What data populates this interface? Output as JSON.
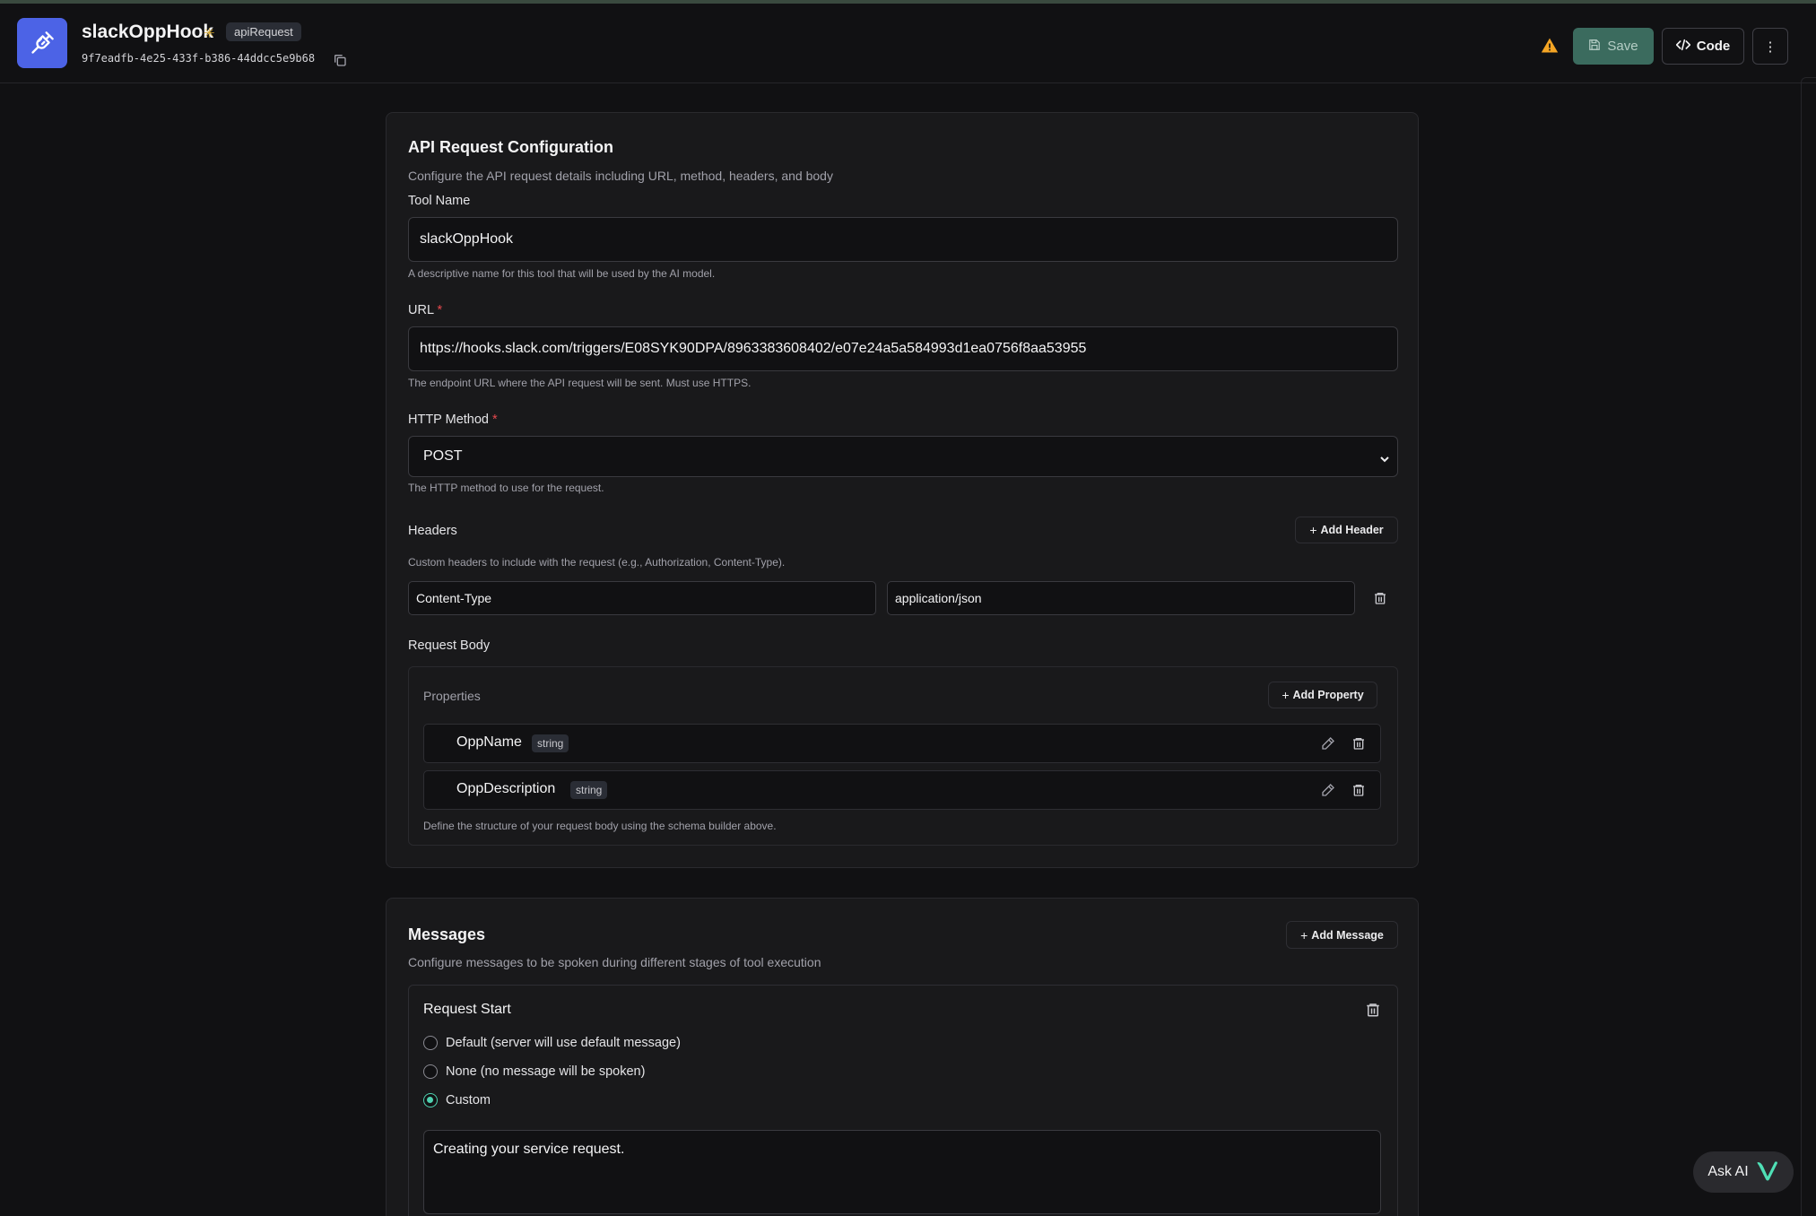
{
  "header": {
    "tool_title": "slackOppHook",
    "star": "✳",
    "type_badge": "apiRequest",
    "tool_id": "9f7eadfb-4e25-433f-b386-44ddcc5e9b68",
    "save_label": "Save",
    "code_label": "Code",
    "more_label": "⋮"
  },
  "config": {
    "title": "API Request Configuration",
    "description": "Configure the API request details including URL, method, headers, and body",
    "tool_name_label": "Tool Name",
    "tool_name_value": "slackOppHook",
    "tool_name_help": "A descriptive name for this tool that will be used by the AI model.",
    "url_label": "URL",
    "required_mark": "*",
    "url_value": "https://hooks.slack.com/triggers/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",
    "url_help": "The endpoint URL where the API request will be sent. Must use HTTPS.",
    "method_label": "HTTP Method",
    "method_value": "POST",
    "method_help": "The HTTP method to use for the request.",
    "headers_label": "Headers",
    "add_header_label": "Add Header",
    "headers_help": "Custom headers to include with the request (e.g., Authorization, Content-Type).",
    "headers": [
      {
        "key": "Content-Type",
        "value": "application/json"
      }
    ],
    "request_body_label": "Request Body",
    "properties_label": "Properties",
    "add_property_label": "Add Property",
    "properties": [
      {
        "name": "OppName",
        "type": "string"
      },
      {
        "name": "OppDescription",
        "type": "string"
      }
    ],
    "body_help": "Define the structure of your request body using the schema builder above."
  },
  "messages": {
    "title": "Messages",
    "description": "Configure messages to be spoken during different stages of tool execution",
    "add_message_label": "Add Message",
    "stage_title": "Request Start",
    "options": [
      {
        "label": "Default (server will use default message)",
        "selected": false
      },
      {
        "label": "None (no message will be spoken)",
        "selected": false
      },
      {
        "label": "Custom",
        "selected": true
      }
    ],
    "custom_text": "Creating your service request."
  },
  "ask_ai_label": "Ask AI",
  "colors": {
    "accent": "#4c63e6",
    "save": "#3b6b5e",
    "radio_on": "#4fd1b0",
    "required": "#e5484d",
    "warning": "#f5a524"
  }
}
